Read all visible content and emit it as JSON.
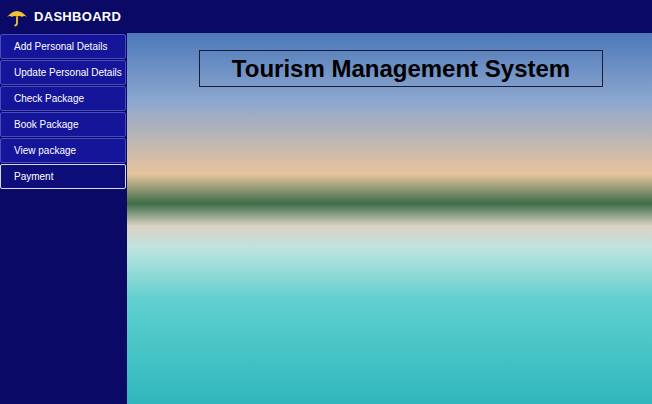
{
  "window": {
    "title": "DASHBOARD"
  },
  "sidebar": {
    "items": [
      {
        "label": "Add Personal Details",
        "selected": false
      },
      {
        "label": "Update Personal Details",
        "selected": false
      },
      {
        "label": "Check Package",
        "selected": false
      },
      {
        "label": "Book Package",
        "selected": false
      },
      {
        "label": "View package",
        "selected": false
      },
      {
        "label": "Payment",
        "selected": true
      }
    ]
  },
  "banner": {
    "title": "Tourism Management System"
  }
}
